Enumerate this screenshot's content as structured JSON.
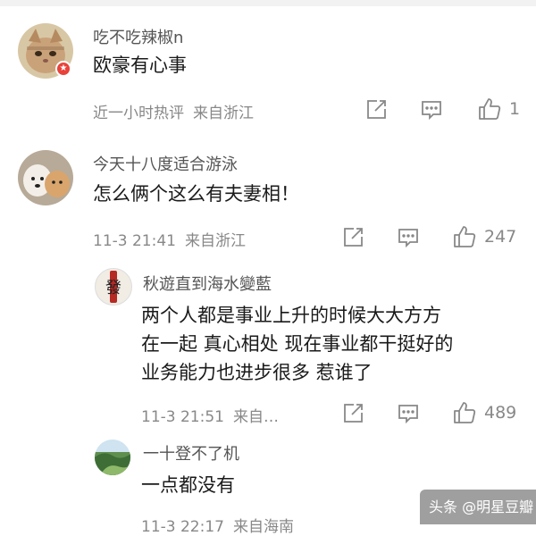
{
  "comments": [
    {
      "username": "吃不吃辣椒n",
      "text": "欧豪有心事",
      "time": "近一小时热评",
      "location": "来自浙江",
      "likes": "1",
      "avatar_icon": "cat-avatar-icon",
      "vip": true
    },
    {
      "username": "今天十八度适合游泳",
      "text": "怎么俩个这么有夫妻相！",
      "time": "11-3 21:41",
      "location": "来自浙江",
      "likes": "247",
      "avatar_icon": "dogs-avatar-icon"
    }
  ],
  "replies": [
    {
      "username": "秋遊直到海水變藍",
      "lines": [
        "两个人都是事业上升的时候大大方方",
        "在一起 真心相处 现在事业都干挺好的",
        "业务能力也进步很多 惹谁了"
      ],
      "time": "11-3 21:51",
      "location": "来自…",
      "likes": "489",
      "avatar_char": "發"
    },
    {
      "username": "一十登不了机",
      "text": "一点都没有",
      "time": "11-3 22:17",
      "location": "来自海南",
      "avatar_icon": "landscape-avatar-icon"
    }
  ],
  "watermark": "头条 @明星豆瓣",
  "icons": [
    "share-icon",
    "comment-icon",
    "thumbs-up-icon"
  ],
  "colors": {
    "meta": "#888888",
    "badge": "#e8423a"
  }
}
